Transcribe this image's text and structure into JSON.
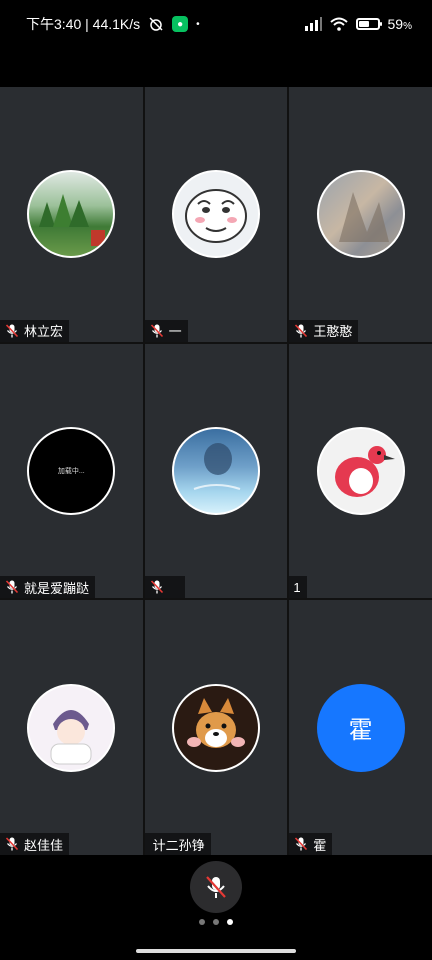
{
  "status_bar": {
    "time_speed": "下午3:40 | 44.1K/s",
    "battery": "59",
    "battery_unit": "%",
    "battery_level": 0.59,
    "icons": [
      "alarm-off-icon",
      "wechat-icon",
      "dot",
      "signal-icon",
      "wifi-icon",
      "battery-icon"
    ]
  },
  "colors": {
    "tile_bg": "#2a2d31",
    "accent_blue": "#1677ff",
    "muted_red": "#e53935"
  },
  "participants": [
    {
      "name": "林立宏",
      "muted": true,
      "avatar": "landscape-photo"
    },
    {
      "name": "一",
      "muted": true,
      "avatar": "cartoon-face"
    },
    {
      "name": "王憨憨",
      "muted": true,
      "avatar": "painting"
    },
    {
      "name": "就是爱蹦跶",
      "muted": true,
      "avatar": "dark-text",
      "avatar_text": "加载中..."
    },
    {
      "name": "",
      "muted": true,
      "avatar": "underwater-photo"
    },
    {
      "name": "1",
      "muted": false,
      "avatar": "lychee-bird"
    },
    {
      "name": "赵佳佳",
      "muted": true,
      "avatar": "anime-boy"
    },
    {
      "name": "计二孙铮",
      "muted": false,
      "avatar": "shiba-dog"
    },
    {
      "name": "霍",
      "muted": true,
      "avatar": "initial",
      "initial": "霍"
    }
  ],
  "bottom": {
    "mic_state": "muted",
    "pages": 3,
    "active_page": 3
  }
}
